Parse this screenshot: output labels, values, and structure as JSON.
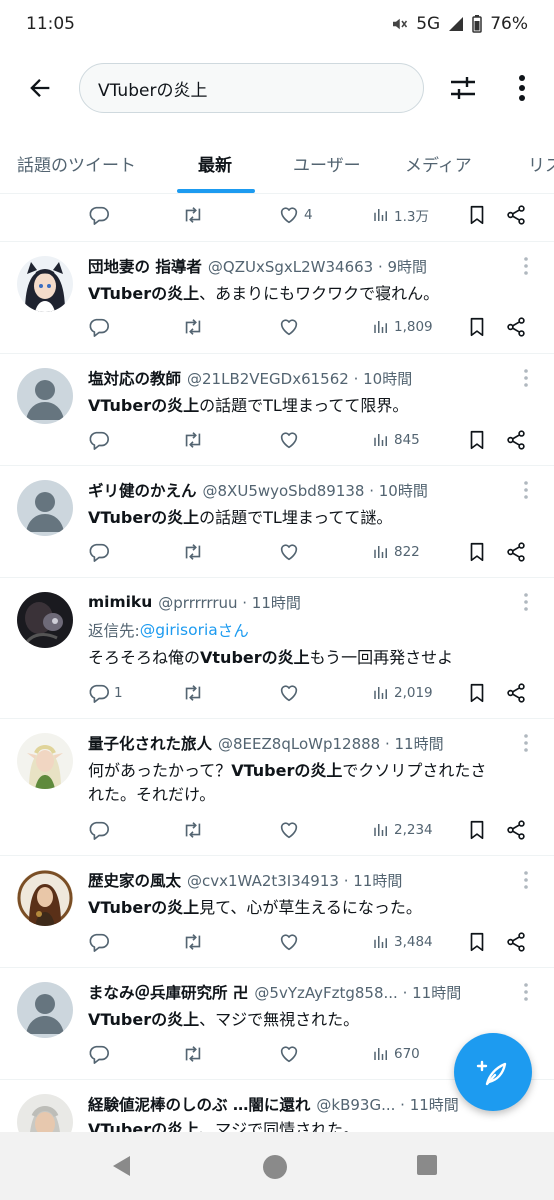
{
  "status": {
    "time": "11:05",
    "network": "5G",
    "battery": "76%"
  },
  "search": {
    "query": "VTuberの炎上"
  },
  "tabs": [
    {
      "label": "話題のツイート"
    },
    {
      "label": "最新"
    },
    {
      "label": "ユーザー"
    },
    {
      "label": "メディア"
    },
    {
      "label": "リス"
    }
  ],
  "top_partial": {
    "reply_count": "",
    "like_count": "4",
    "views": "1.3万"
  },
  "tweets": [
    {
      "name": "団地妻の 指導者",
      "meta": "@QZUxSgxL2W34663 · 9時間",
      "text_bold": "VTuberの炎上",
      "text_rest": "、あまりにもワクワクで寝れん。",
      "replies": "",
      "likes": "",
      "views": "1,809",
      "avatar": "anime-girl-avatar"
    },
    {
      "name": "塩対応の教師",
      "meta": "@21LB2VEGDx61562 · 10時間",
      "text_bold": "VTuberの炎上",
      "text_rest": "の話題でTL埋まってて限界。",
      "replies": "",
      "likes": "",
      "views": "845",
      "avatar": "default-avatar"
    },
    {
      "name": "ギリ健のかえん",
      "meta": "@8XU5wyoSbd89138 · 10時間",
      "text_bold": "VTuberの炎上",
      "text_rest": "の話題でTL埋まってて謎。",
      "replies": "",
      "likes": "",
      "views": "822",
      "avatar": "default-avatar"
    },
    {
      "name": "mimiku",
      "meta": "@prrrrrruu · 11時間",
      "reply_prefix": "返信先: ",
      "reply_handle": "@girisoria",
      "reply_suffix": "さん",
      "text_pre": "そろそろね俺の",
      "text_bold": "Vtuberの炎上",
      "text_rest": "もう一回再発させよ",
      "replies": "1",
      "likes": "",
      "views": "2,019",
      "avatar": "photo-avatar"
    },
    {
      "name": "量子化された旅人",
      "meta": "@8EEZ8qLoWp12888 · 11時間",
      "text_line1_pre": "何があったかって？",
      "text_line1_bold": "VTuberの炎上",
      "text_line1_rest": "でクソリプされたさ",
      "text_line2": "れた。それだけ。",
      "replies": "",
      "likes": "",
      "views": "2,234",
      "avatar": "elf-avatar"
    },
    {
      "name": "歴史家の風太",
      "meta": "@cvx1WA2t3I34913 · 11時間",
      "text_bold": "VTuberの炎上",
      "text_rest": "見て、心が草生えるになった。",
      "replies": "",
      "likes": "",
      "views": "3,484",
      "avatar": "steampunk-avatar"
    },
    {
      "name": "まなみ＠兵庫研究所 卍",
      "meta": "@5vYzAyFztg858... · 11時間",
      "text_bold": "VTuberの炎上",
      "text_rest": "、マジで無視された。",
      "replies": "",
      "likes": "",
      "views": "670",
      "avatar": "default-avatar"
    },
    {
      "name": "経験値泥棒のしのぶ …闇に還れ",
      "meta": "@kB93G... · 11時間",
      "text_bold": "VTuberの炎上",
      "text_rest": "、マジで同情された。",
      "avatar": "elderly-avatar"
    }
  ],
  "colors": {
    "accent": "#1d9bf0",
    "text": "#0f1419",
    "muted": "#536471",
    "border": "#eff3f4"
  },
  "icons": [
    "back-arrow-icon",
    "filter-icon",
    "more-vertical-icon",
    "reply-icon",
    "retweet-icon",
    "like-icon",
    "views-icon",
    "bookmark-icon",
    "share-icon",
    "compose-icon"
  ]
}
